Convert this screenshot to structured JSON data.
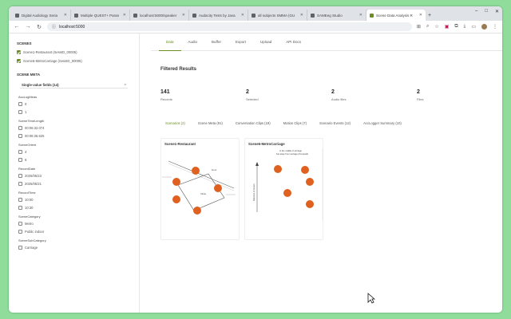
{
  "browser": {
    "tabs": [
      {
        "label": "Digital Audiology Seria"
      },
      {
        "label": "Multiple QUEST+ Paran"
      },
      {
        "label": "localhost:5000/speaker"
      },
      {
        "label": "Audacity Tests by Java"
      },
      {
        "label": "all subjects SMMA (GU"
      },
      {
        "label": "SAMEeg Studio"
      },
      {
        "label": "Scene Data Analysis R"
      }
    ],
    "new_tab": "+",
    "url": "localhost:5000",
    "window_controls": {
      "minimize": "–",
      "maximize": "□",
      "close": "✕"
    }
  },
  "sidebar": {
    "scenes_heading": "SCENES",
    "scenes": [
      {
        "label": "Scene1-Restaurant (SessID_00005)",
        "checked": true
      },
      {
        "label": "Scene6-MetroCarriage (SessID_00005)",
        "checked": true
      }
    ],
    "meta_heading": "SCENE META",
    "fold_label": "Single-value fields (14)",
    "fold_icon": "^",
    "fields": [
      {
        "name": "AccLogMeas",
        "options": [
          "0",
          "1"
        ]
      },
      {
        "name": "SceneTimeLength",
        "options": [
          "00:06:32.074",
          "00:06:36.625"
        ]
      },
      {
        "name": "SceneOrient",
        "options": [
          "4",
          "6"
        ]
      },
      {
        "name": "RecordDate",
        "options": [
          "2025/05/23",
          "2025/05/21"
        ]
      },
      {
        "name": "RecordTime",
        "options": [
          "10:00",
          "10:30"
        ]
      },
      {
        "name": "SceneCategory",
        "options": [
          "Metro",
          "Public indoor"
        ]
      },
      {
        "name": "SceneSubCategory",
        "options": [
          "Carriage"
        ]
      }
    ]
  },
  "main": {
    "tabs": [
      {
        "label": "Data",
        "active": true
      },
      {
        "label": "Audio",
        "active": false
      },
      {
        "label": "Buffer",
        "active": false
      },
      {
        "label": "Export",
        "active": false
      },
      {
        "label": "Upload",
        "active": false
      },
      {
        "label": "API Docs",
        "active": false
      }
    ],
    "filtered_title": "Filtered Results",
    "metrics": [
      {
        "value": "141",
        "label": "Records"
      },
      {
        "value": "2",
        "label": "Selected"
      },
      {
        "value": "2",
        "label": "Audio files"
      },
      {
        "value": "2",
        "label": "Files"
      }
    ],
    "subtabs": [
      {
        "label": "Scenarios (2)",
        "active": true
      },
      {
        "label": "Scene Meta (91)",
        "active": false
      },
      {
        "label": "Conversation Clips (19)",
        "active": false
      },
      {
        "label": "Motion Clips (7)",
        "active": false
      },
      {
        "label": "Scenario Events (12)",
        "active": false
      },
      {
        "label": "AccLogger Summary (10)",
        "active": false
      }
    ],
    "cards": [
      {
        "title": "Scene1-Restaurant",
        "labels": {
          "side": "Table",
          "door": "Door"
        }
      },
      {
        "title": "Scene6-MetroCarriage",
        "labels": {
          "note1": "In the middle of carriage",
          "note2": "Far away from carriage (Occupied)",
          "axis": "Direction of motion"
        }
      }
    ]
  },
  "colors": {
    "accent": "#6b8e23",
    "seat": "#e0601f",
    "bg": "#8fdc9b"
  }
}
